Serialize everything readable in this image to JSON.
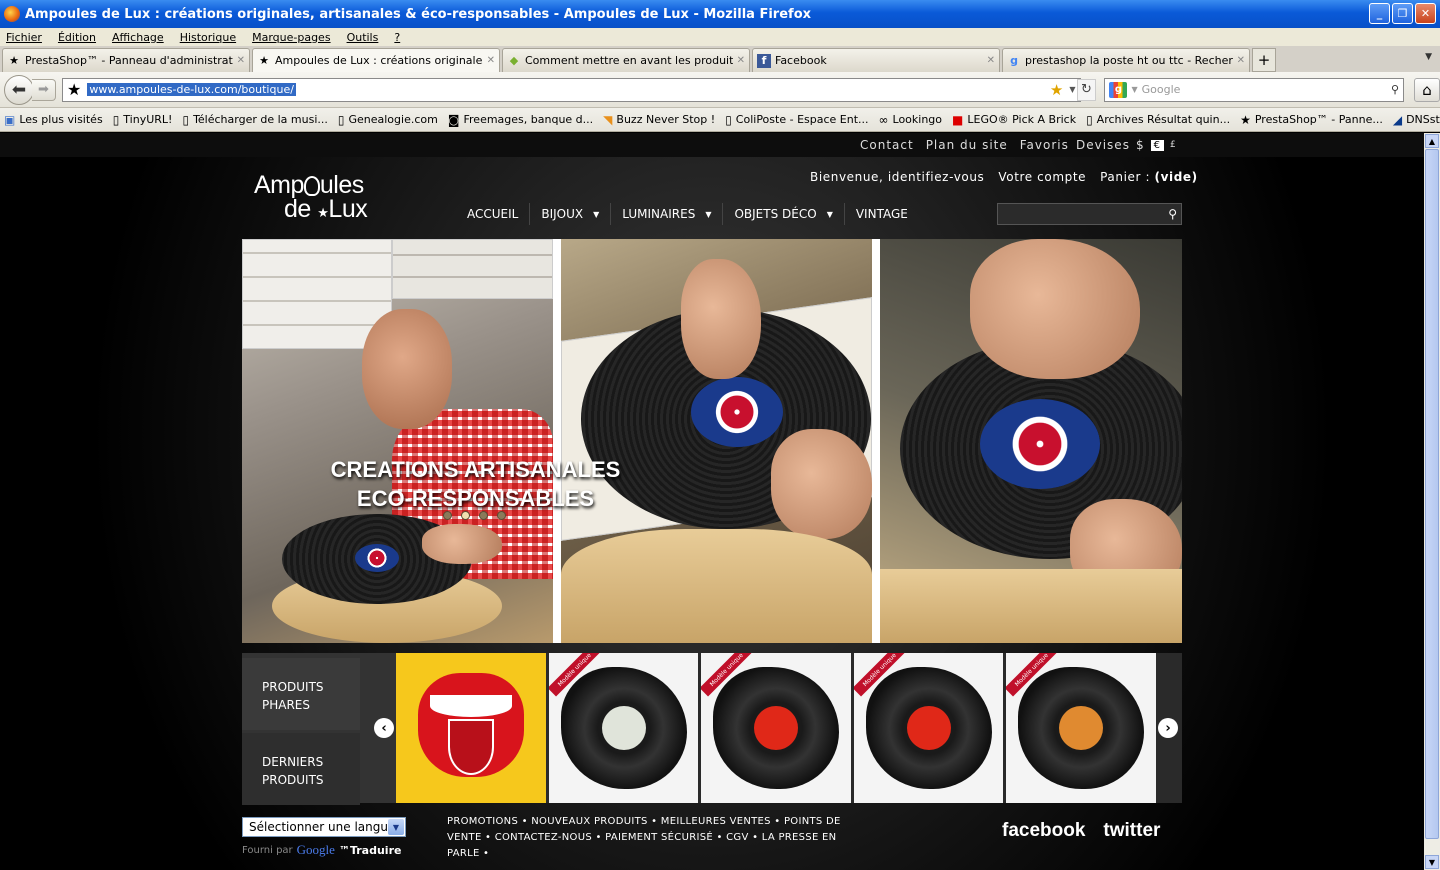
{
  "window": {
    "title": "Ampoules de Lux : créations originales, artisanales & éco-responsables - Ampoules de Lux - Mozilla Firefox",
    "minimize": "_",
    "restore": "❐",
    "close": "✕"
  },
  "menu": [
    "Fichier",
    "Édition",
    "Affichage",
    "Historique",
    "Marque-pages",
    "Outils",
    "?"
  ],
  "tabs": [
    {
      "label": "PrestaShop™ - Panneau d'administration",
      "icon": "star-icon",
      "active": false
    },
    {
      "label": "Ampoules de Lux : créations originales, a...",
      "icon": "star-icon",
      "active": true
    },
    {
      "label": "Comment mettre en avant les produits p...",
      "icon": "prestashop-icon",
      "active": false
    },
    {
      "label": "Facebook",
      "icon": "facebook-icon",
      "active": false
    },
    {
      "label": "prestashop la poste ht ou ttc - Recherch...",
      "icon": "google-icon",
      "active": false
    }
  ],
  "navbar": {
    "url": "www.ampoules-de-lux.com/boutique/",
    "search_placeholder": "Google"
  },
  "bookmarks": [
    "Les plus visités",
    "TinyURL!",
    "Télécharger de la musi...",
    "Genealogie.com",
    "Freemages, banque d...",
    "Buzz Never Stop !",
    "ColiPoste - Espace Ent...",
    "Lookingo",
    "LEGO® Pick A Brick",
    "Archives Résultat quin...",
    "PrestaShop™ - Panne...",
    "DNSstuff"
  ],
  "site": {
    "top_links": [
      "Contact",
      "Plan du site",
      "Favoris"
    ],
    "devises_label": "Devises",
    "currency_dollar": "$",
    "currency_euro": "€",
    "currency_pound": "£",
    "logo_line1": "Amp",
    "logo_line1b": "ules",
    "logo_line2": "de",
    "logo_line2b": "Lux",
    "user_welcome": "Bienvenue, identifiez-vous",
    "account": "Votre compte",
    "cart_label": "Panier :",
    "cart_value": "(vide)",
    "nav": [
      {
        "label": "ACCUEIL",
        "has_menu": false
      },
      {
        "label": "BIJOUX",
        "has_menu": true
      },
      {
        "label": "LUMINAIRES",
        "has_menu": true
      },
      {
        "label": "OBJETS DÉCO",
        "has_menu": true
      },
      {
        "label": "VINTAGE",
        "has_menu": false
      }
    ],
    "hero_line1": "CREATIONS ARTISANALES",
    "hero_line2": "ECO-RESPONSABLES",
    "slider_active": 2,
    "slider_count": 4,
    "featured_tab1": "PRODUITS PHARES",
    "featured_tab2": "DERNIERS PRODUITS",
    "ribbon": "Modèle unique",
    "thumb_labels": [
      "#d8141c",
      "#e8e8e8",
      "#e02818",
      "#e02818",
      "#e08a30"
    ],
    "lang_select": "Sélectionner une langue",
    "powered_by": "Fourni par",
    "google": "Google",
    "translate": "™Traduire",
    "footer_links": "PROMOTIONS • NOUVEAUX PRODUITS • MEILLEURES VENTES • POINTS DE VENTE • CONTACTEZ-NOUS • PAIEMENT SÉCURISÉ • CGV • LA PRESSE EN PARLE •",
    "facebook": "facebook",
    "twitter": "twitter"
  }
}
